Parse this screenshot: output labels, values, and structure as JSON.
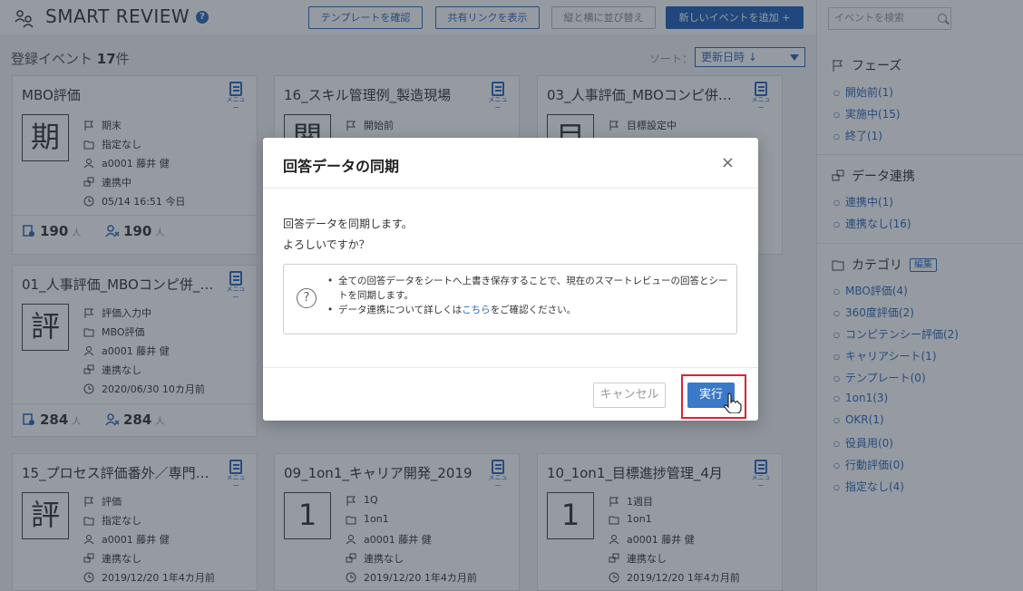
{
  "header": {
    "app_title": "SMART REVIEW",
    "help_icon": "?",
    "btn_template": "テンプレートを確認",
    "btn_share": "共有リンクを表示",
    "btn_arrange": "縦と横に並び替え",
    "btn_add": "新しいイベントを追加 +"
  },
  "list": {
    "count_prefix": "登録イベント",
    "count": "17",
    "count_suffix": "件",
    "sort_label": "ソート：",
    "sort_value": "更新日時 ↓"
  },
  "cards": [
    {
      "title": "MBO評価",
      "menu": "メニュー",
      "icon_char": "期",
      "phase": "期末",
      "category": "指定なし",
      "user": "a0001 藤井 健",
      "link": "連携中",
      "date": "05/14 16:51 今日",
      "respondents": "190",
      "reviewers": "190",
      "unit": "人"
    },
    {
      "title": "16_スキル管理例_製造現場",
      "menu": "メニュー",
      "icon_char": "閲",
      "phase": "開始前"
    },
    {
      "title": "03_人事評価_MBOコンピ併…",
      "menu": "メニュー",
      "icon_char": "目",
      "phase": "目標設定中"
    },
    {
      "title": "01_人事評価_MBOコンピ併_…",
      "menu": "メニュー",
      "icon_char": "評",
      "phase": "評価入力中",
      "category": "MBO評価",
      "user": "a0001 藤井 健",
      "link": "連携なし",
      "date": "2020/06/30 10カ月前",
      "respondents": "284",
      "reviewers": "284",
      "unit": "人"
    },
    {
      "title": "15_プロセス評価番外／専門…",
      "menu": "メニュー",
      "icon_char": "評",
      "phase": "評価",
      "category": "指定なし",
      "user": "a0001 藤井 健",
      "link": "連携なし",
      "date": "2019/12/20 1年4カ月前"
    },
    {
      "title": "09_1on1_キャリア開発_2019",
      "menu": "メニュー",
      "icon_char": "1",
      "phase": "1Q",
      "category": "1on1",
      "user": "a0001 藤井 健",
      "link": "連携なし",
      "date": "2019/12/20 1年4カ月前"
    },
    {
      "title": "10_1on1_目標進捗管理_4月",
      "menu": "メニュー",
      "icon_char": "1",
      "phase": "1週目",
      "category": "1on1",
      "user": "a0001 藤井 健",
      "link": "連携なし",
      "date": "2019/12/20 1年4カ月前"
    }
  ],
  "sidebar": {
    "search_placeholder": "イベントを検索",
    "phase_heading": "フェーズ",
    "phase_items": [
      "開始前(1)",
      "実施中(15)",
      "終了(1)"
    ],
    "link_heading": "データ連携",
    "link_items": [
      "連携中(1)",
      "連携なし(16)"
    ],
    "category_heading": "カテゴリ",
    "category_edit": "編集",
    "category_items": [
      "MBO評価(4)",
      "360度評価(2)",
      "コンピテンシー評価(2)",
      "キャリアシート(1)",
      "テンプレート(0)",
      "1on1(3)",
      "OKR(1)",
      "役員用(0)",
      "行動評価(0)",
      "指定なし(4)"
    ]
  },
  "modal": {
    "title": "回答データの同期",
    "close": "×",
    "line1": "回答データを同期します。",
    "line2": "よろしいですか？",
    "info1": "全ての回答データをシートへ上書き保存することで、現在のスマートレビューの回答とシートを同期します。",
    "info2_pre": "データ連携について詳しくは",
    "info2_link": "こちら",
    "info2_post": "をご確認ください。",
    "cancel": "キャンセル",
    "run": "実行"
  },
  "colors": {
    "accent": "#2a66b8",
    "primary_button": "#1f5fb6",
    "highlight": "#d9252b"
  }
}
